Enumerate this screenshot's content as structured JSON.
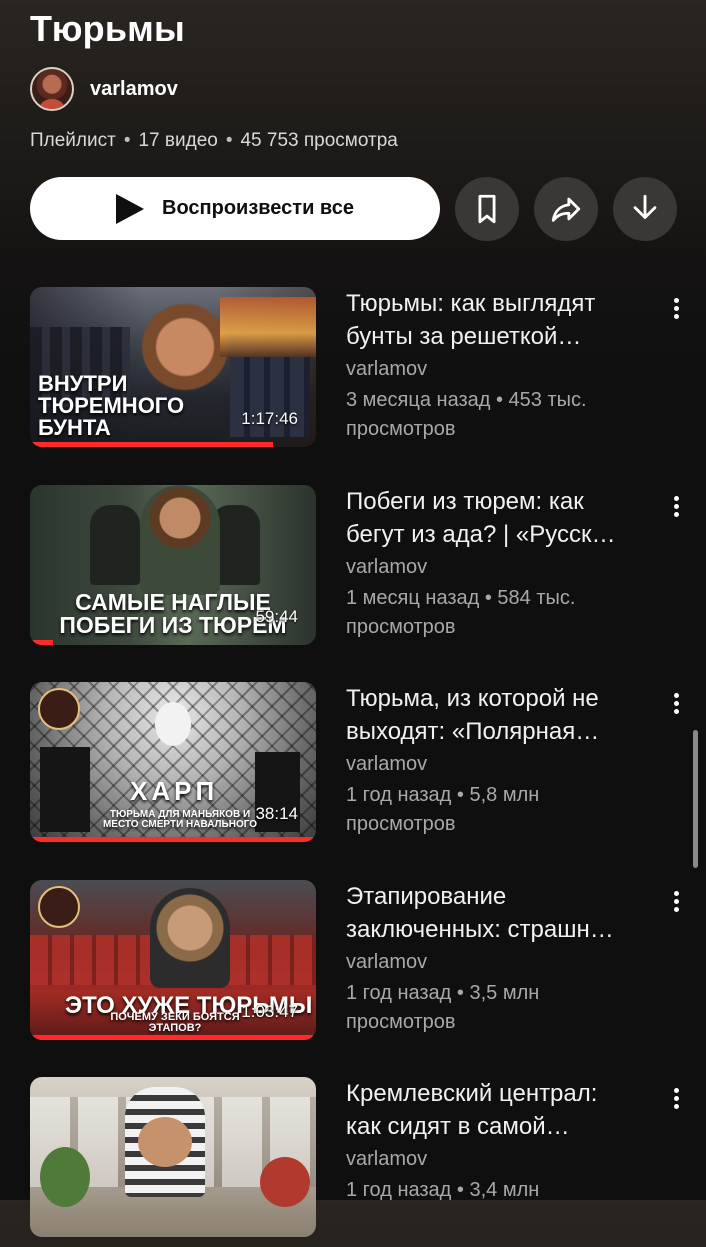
{
  "playlist": {
    "title": "Тюрьмы",
    "channel": "varlamov",
    "type": "Плейлист",
    "video_count": "17 видео",
    "views": "45 753 просмотра",
    "separator": "•"
  },
  "actions": {
    "play_all": "Воспроизвести все",
    "save_icon": "bookmark-icon",
    "share_icon": "share-icon",
    "download_icon": "download-icon"
  },
  "videos": [
    {
      "title": "Тюрьмы: как выглядят бунты за решеткой…",
      "channel": "varlamov",
      "meta": "3 месяца назад • 453 тыс. просмотров",
      "duration": "1:17:46",
      "thumb_text": "ВНУТРИ ТЮРЕМНОГО БУНТА",
      "progress": 0.85
    },
    {
      "title": "Побеги из тюрем: как бегут из ада? | «Русск…",
      "channel": "varlamov",
      "meta": "1 месяц назад • 584 тыс. просмотров",
      "duration": "59:44",
      "thumb_text": "САМЫЕ НАГЛЫЕ ПОБЕГИ ИЗ ТЮРЕМ",
      "progress": 0.08
    },
    {
      "title": "Тюрьма, из которой не выходят: «Полярная…",
      "channel": "varlamov",
      "meta": "1 год назад • 5,8 млн просмотров",
      "duration": "38:14",
      "thumb_text": "ХАРП",
      "thumb_subtext": "ТЮРЬМА ДЛЯ МАНЬЯКОВ И МЕСТО СМЕРТИ НАВАЛЬНОГО",
      "progress": 0.99
    },
    {
      "title": "Этапирование заключенных: страшн…",
      "channel": "varlamov",
      "meta": "1 год назад • 3,5 млн просмотров",
      "duration": "1:03:47",
      "thumb_text": "ЭТО ХУЖЕ ТЮРЬМЫ",
      "thumb_subtext": "ПОЧЕМУ ЗЕКИ БОЯТСЯ ЭТАПОВ?",
      "progress": 0.99
    },
    {
      "title": "Кремлевский централ: как сидят в самой…",
      "channel": "varlamov",
      "meta": "1 год назад • 3,4 млн",
      "duration": "",
      "thumb_text": "",
      "progress": 0
    }
  ],
  "colors": {
    "accent": "#ff2b2b",
    "background": "#0f0f0f",
    "secondary_text": "#a8a8a8"
  }
}
